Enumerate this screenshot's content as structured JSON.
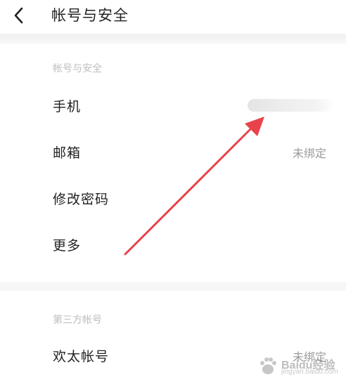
{
  "header": {
    "title": "帐号与安全",
    "back_icon": "chevron-left-icon"
  },
  "sections": {
    "account": {
      "label": "帐号与安全",
      "rows": [
        {
          "label": "手机",
          "value": ""
        },
        {
          "label": "邮箱",
          "value": "未绑定"
        },
        {
          "label": "修改密码",
          "value": ""
        },
        {
          "label": "更多",
          "value": ""
        }
      ]
    },
    "third_party": {
      "label": "第三方帐号",
      "rows": [
        {
          "label": "欢太帐号",
          "value": "未绑定"
        }
      ]
    }
  },
  "overlay": {
    "arrow_color": "#e8434b",
    "watermark": "Baidu经验",
    "watermark_sub": "jingyan.baidu.com"
  }
}
